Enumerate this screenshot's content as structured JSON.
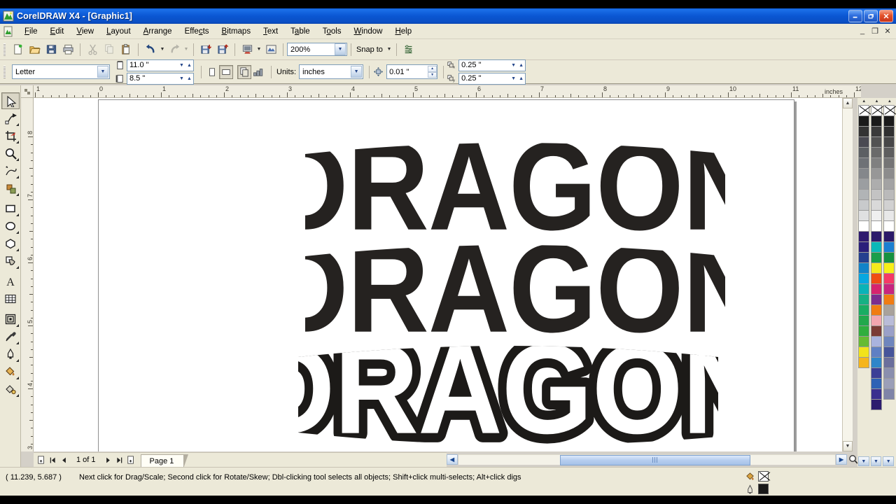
{
  "window": {
    "title": "CorelDRAW X4 - [Graphic1]",
    "app_icon": "coreldraw-icon",
    "controls": {
      "minimize": "_",
      "restore": "❐",
      "close": "✕"
    },
    "mdi_controls": {
      "minimize": "_",
      "restore": "❐",
      "close": "✕"
    }
  },
  "menubar": {
    "doc_icon": "document-icon",
    "items": [
      {
        "label": "File",
        "accel": "F"
      },
      {
        "label": "Edit",
        "accel": "E"
      },
      {
        "label": "View",
        "accel": "V"
      },
      {
        "label": "Layout",
        "accel": "L"
      },
      {
        "label": "Arrange",
        "accel": "A"
      },
      {
        "label": "Effects",
        "accel": "c"
      },
      {
        "label": "Bitmaps",
        "accel": "B"
      },
      {
        "label": "Text",
        "accel": "T"
      },
      {
        "label": "Table",
        "accel": "a"
      },
      {
        "label": "Tools",
        "accel": "o"
      },
      {
        "label": "Window",
        "accel": "W"
      },
      {
        "label": "Help",
        "accel": "H"
      }
    ]
  },
  "standard_toolbar": {
    "buttons": [
      {
        "name": "new-document-button",
        "enabled": true
      },
      {
        "name": "open-document-button",
        "enabled": true
      },
      {
        "name": "save-document-button",
        "enabled": true
      },
      {
        "name": "print-button",
        "enabled": true
      },
      {
        "name": "cut-button",
        "enabled": false
      },
      {
        "name": "copy-button",
        "enabled": false
      },
      {
        "name": "paste-button",
        "enabled": true
      },
      {
        "name": "undo-button",
        "enabled": true
      },
      {
        "name": "redo-button",
        "enabled": false
      },
      {
        "name": "import-button",
        "enabled": true
      },
      {
        "name": "export-button",
        "enabled": true
      },
      {
        "name": "application-launcher-button",
        "enabled": true
      },
      {
        "name": "corel-online-button",
        "enabled": true
      }
    ],
    "zoom_level": "200%",
    "snap_to_label": "Snap to",
    "options_button": "options-icon"
  },
  "property_bar": {
    "paper_type": "Letter",
    "page_width": "11.0 \"",
    "page_height": "8.5 \"",
    "orientation": {
      "portrait": "portrait-icon",
      "landscape": "landscape-icon",
      "selected": "landscape"
    },
    "page_scope_button": "all-pages-icon",
    "page_scope_button2": "current-page-icon",
    "units_label": "Units:",
    "units_value": "inches",
    "nudge_value": "0.01 \"",
    "duplicate_x": "0.25 \"",
    "duplicate_y": "0.25 \""
  },
  "toolbox": {
    "tools": [
      {
        "name": "pick-tool",
        "glyph": "cursor",
        "selected": true,
        "flyout": false
      },
      {
        "name": "shape-tool",
        "glyph": "node",
        "selected": false,
        "flyout": true
      },
      {
        "name": "crop-tool",
        "glyph": "crop",
        "selected": false,
        "flyout": true
      },
      {
        "name": "zoom-tool",
        "glyph": "magnifier",
        "selected": false,
        "flyout": true
      },
      {
        "name": "freehand-tool",
        "glyph": "freehand",
        "selected": false,
        "flyout": true
      },
      {
        "name": "smart-fill-tool",
        "glyph": "smartfill",
        "selected": false,
        "flyout": true
      },
      {
        "name": "rectangle-tool",
        "glyph": "rect",
        "selected": false,
        "flyout": true
      },
      {
        "name": "ellipse-tool",
        "glyph": "ellipse",
        "selected": false,
        "flyout": true
      },
      {
        "name": "polygon-tool",
        "glyph": "polygon",
        "selected": false,
        "flyout": true
      },
      {
        "name": "basic-shapes-tool",
        "glyph": "shapes",
        "selected": false,
        "flyout": true
      },
      {
        "name": "text-tool",
        "glyph": "textA",
        "selected": false,
        "flyout": false
      },
      {
        "name": "table-tool",
        "glyph": "table",
        "selected": false,
        "flyout": false
      },
      {
        "name": "interactive-blend-tool",
        "glyph": "blend",
        "selected": false,
        "flyout": true
      },
      {
        "name": "eyedropper-tool",
        "glyph": "dropper",
        "selected": false,
        "flyout": true
      },
      {
        "name": "outline-tool",
        "glyph": "pen",
        "selected": false,
        "flyout": true
      },
      {
        "name": "fill-tool",
        "glyph": "bucket",
        "selected": false,
        "flyout": true
      },
      {
        "name": "interactive-fill-tool",
        "glyph": "ifill",
        "selected": false,
        "flyout": true
      }
    ]
  },
  "rulers": {
    "units": "inches",
    "h_labels": [
      "1",
      "0",
      "1",
      "2",
      "3",
      "4",
      "5",
      "6",
      "7",
      "8",
      "9",
      "10",
      "11"
    ],
    "v_labels": [
      "8",
      "7",
      "6",
      "5",
      "4"
    ]
  },
  "canvas": {
    "artwork_text": "DRAGON",
    "objects": [
      {
        "name": "dragon-text-top",
        "style": "filled-arch",
        "fill": "#252220",
        "outline": "none"
      },
      {
        "name": "dragon-text-middle",
        "style": "filled-arch",
        "fill": "#252220",
        "outline": "none"
      },
      {
        "name": "dragon-text-bottom",
        "style": "outlined-arch",
        "fill": "#ffffff",
        "outline": "#1c1a18"
      }
    ]
  },
  "page_navigator": {
    "add_page_start": "add-page-icon",
    "first_page": "◀|",
    "prev_page": "◀",
    "page_count_label": "1 of 1",
    "next_page": "▶",
    "last_page": "|▶",
    "add_page_end": "add-page-icon",
    "tabs": [
      {
        "label": "Page 1",
        "active": true
      }
    ]
  },
  "palette": {
    "columns": [
      [
        "none",
        "#1a1a1a",
        "#333333",
        "#4a4a52",
        "#5c5f63",
        "#6e7176",
        "#84878b",
        "#9b9ea1",
        "#b1b4b6",
        "#c8cacc",
        "#dfe0e1",
        "#ffffff",
        "#2e1a6e",
        "#2a1f7a",
        "#25408f",
        "#1283c8",
        "#07a7e0",
        "#0ab3b8",
        "#16b184",
        "#19ad63",
        "#22a84c",
        "#2fae3e",
        "#66bb33",
        "#f2e31a",
        "#f5b51c"
      ],
      [
        "none",
        "#1a1a1a",
        "#3a3a3a",
        "#525252",
        "#6a6a6a",
        "#808080",
        "#979797",
        "#adadad",
        "#c3c3c3",
        "#d9d9d9",
        "#efefef",
        "#ffffff",
        "#2c1b6b",
        "#0bb8b8",
        "#1a9e4b",
        "#f5ea1c",
        "#f04e12",
        "#d6246e",
        "#7b2d8e",
        "#f07c12",
        "#f2a6b0",
        "#7a3b35",
        "#a9b3de",
        "#5f80c4",
        "#2f86c9",
        "#3b3f96",
        "#2d62b5",
        "#3a2f8f",
        "#2c1c6e"
      ],
      [
        "none",
        "#1a1a1a",
        "#303030",
        "#474747",
        "#5e5e5e",
        "#757575",
        "#8c8c8c",
        "#a3a3a3",
        "#bababa",
        "#d1d1d1",
        "#e8e8e8",
        "#ffffff",
        "#2b1a68",
        "#1b7fd1",
        "#16913f",
        "#f7ef18",
        "#f53a66",
        "#c8257e",
        "#f07c12",
        "#a9a29b",
        "#b9bcd8",
        "#9aa0c8",
        "#6f86bd",
        "#46559a",
        "#6b6f9c",
        "#8a8fae",
        "#9b9fb8",
        "#7f84a8"
      ]
    ],
    "scroll_up": "▲",
    "scroll_down": "▼"
  },
  "status_bar": {
    "coordinates": "( 11.239, 5.687  )",
    "message": "Next click for Drag/Scale; Second click for Rotate/Skew; Dbl-clicking tool selects all objects; Shift+click multi-selects; Alt+click digs",
    "fill_label": "fill-swatch",
    "fill_value": "none",
    "outline_label": "outline-swatch",
    "outline_value": "#1a1a1a"
  },
  "colors": {
    "title_blue": "#0a56d2",
    "chrome": "#ece9d8",
    "artwork_dark": "#252220",
    "canvas_white": "#ffffff"
  }
}
